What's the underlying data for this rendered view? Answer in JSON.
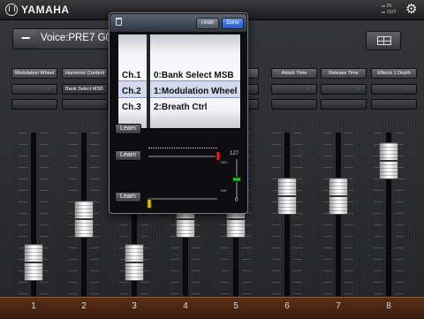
{
  "header": {
    "brand": "YAMAHA",
    "io_in": "IN",
    "io_out": "OUT"
  },
  "voice": {
    "label": "Voice:PRE7 G08:",
    "minus_label": "−"
  },
  "selectors": [
    {
      "label": "Modulation Wheel",
      "sub": ""
    },
    {
      "label": "Harmonic Content",
      "sub": "Bank Select MSB"
    },
    {
      "label": "",
      "sub": ""
    },
    {
      "label": "",
      "sub": ""
    },
    {
      "label": "",
      "sub": "MSB"
    },
    {
      "label": "Attack Time",
      "sub": ""
    },
    {
      "label": "Release Time",
      "sub": ""
    },
    {
      "label": "Effects 1 Depth",
      "sub": ""
    }
  ],
  "faders": [
    {
      "number": "1",
      "level": 0.12
    },
    {
      "number": "2",
      "level": 0.46
    },
    {
      "number": "3",
      "level": 0.12
    },
    {
      "number": "4",
      "level": 0.46
    },
    {
      "number": "5",
      "level": 0.46
    },
    {
      "number": "6",
      "level": 0.64
    },
    {
      "number": "7",
      "level": 0.64
    },
    {
      "number": "8",
      "level": 0.92
    }
  ],
  "popover": {
    "undo_label": "Undo",
    "done_label": "Done",
    "picker_rows": [
      {
        "ch": "Ch.1",
        "value": "0:Bank Select MSB"
      },
      {
        "ch": "Ch.2",
        "value": "1:Modulation Wheel"
      },
      {
        "ch": "Ch.3",
        "value": "2:Breath Ctrl"
      }
    ],
    "learn_label": "Learn",
    "max_value": "127",
    "min_value": "0",
    "tiny_max": "MAX",
    "tiny_min": "MIN"
  }
}
